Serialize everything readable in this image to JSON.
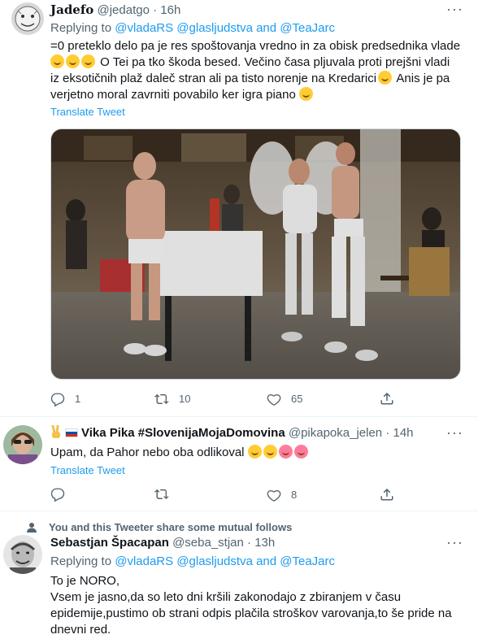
{
  "tweets": [
    {
      "display_name": "Jadefo",
      "handle": "@jedatgo",
      "time": "16h",
      "replying_prefix": "Replying to",
      "replying_accounts": "@vladaRS @glasljudstva and @TeaJarc",
      "text_lines": [
        "=0 preteklo delo pa je res spoštovanja vredno in za obisk predsednika vlade",
        "O Tei pa tko škoda besed. Večino časa pljuvala proti prejšni vladi",
        "iz eksotičnih plaž daleč stran ali pa tisto norenje na Kredarici",
        "Anis je pa",
        "verjetno moral zavrniti povabilo ker igra piano"
      ],
      "translate": "Translate Tweet",
      "counts": {
        "replies": "1",
        "retweets": "10",
        "likes": "65"
      }
    },
    {
      "display_name": "Vika Pika #SlovenijaMojaDomovina",
      "handle": "@pikapoka_jelen",
      "time": "14h",
      "text": "Upam, da Pahor nebo oba odlikoval",
      "translate": "Translate Tweet",
      "counts": {
        "replies": "",
        "retweets": "",
        "likes": "8"
      }
    },
    {
      "mutual_note": "You and this Tweeter share some mutual follows",
      "display_name": "Sebastjan Špacapan",
      "handle": "@seba_stjan",
      "time": "13h",
      "replying_prefix": "Replying to",
      "replying_accounts": "@vladaRS @glasljudstva and @TeaJarc",
      "text_lines": [
        "To je NORO,",
        "Vsem je jasno,da so leto dni kršili zakonodajo z zbiranjem v času",
        "epidemije,pustimo ob strani odpis plačila stroškov varovanja,to še pride na",
        "dnevni red."
      ]
    }
  ],
  "separator": "·",
  "icons": [
    "more-icon",
    "reply-icon",
    "retweet-icon",
    "like-icon",
    "share-icon",
    "person-icon"
  ],
  "colors": {
    "link": "#1d9bf0",
    "muted": "#536471",
    "text": "#0f1419"
  }
}
